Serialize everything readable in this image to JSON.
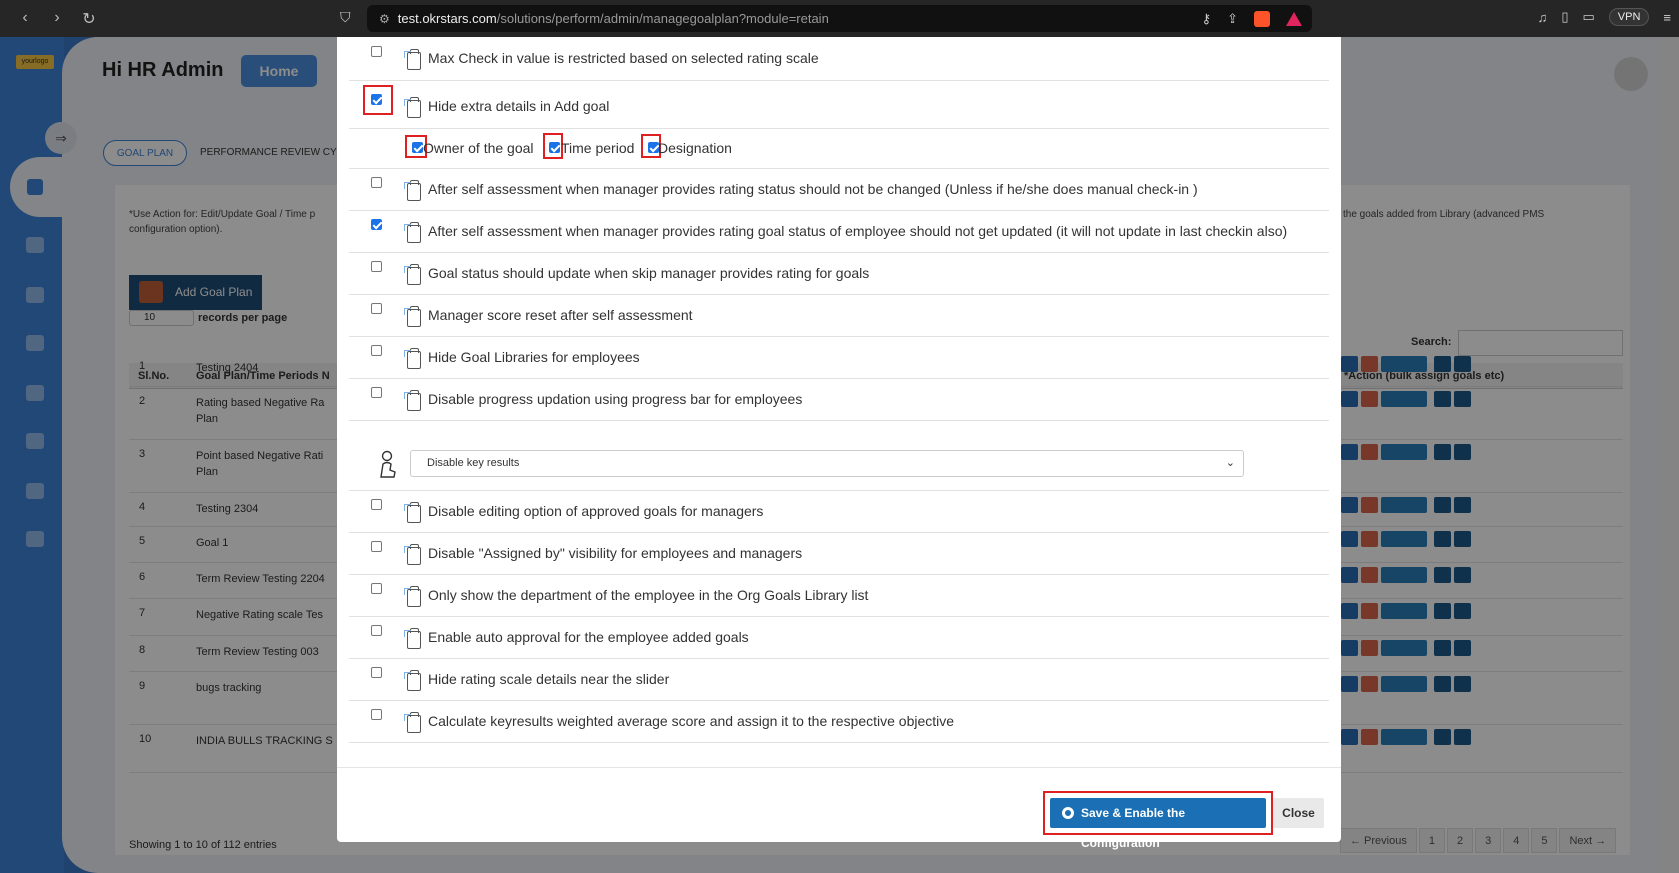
{
  "browser": {
    "url_host": "test.okrstars.com",
    "url_path": "/solutions/perform/admin/managegoalplan?module=retain",
    "vpn_label": "VPN"
  },
  "app": {
    "logo_text": "yourlogo",
    "greeting": "Hi HR Admin",
    "home_label": "Home",
    "tabs": [
      "GOAL PLAN",
      "PERFORMANCE REVIEW CY"
    ],
    "note_left": "*Use Action for: Edit/Update Goal / Time p configuration option).",
    "note_right": "the goals added from Library (advanced PMS",
    "add_goal_plan": "Add Goal Plan",
    "records_per_page_value": "10",
    "records_per_page_label": "records per page",
    "search_label": "Search:",
    "table": {
      "headers": [
        "Sl.No.",
        "Goal Plan/Time Periods N",
        "*Action (bulk assign goals etc)"
      ],
      "rows": [
        {
          "n": "1",
          "name": "Testing 2404"
        },
        {
          "n": "2",
          "name": "Rating based Negative Ra Plan"
        },
        {
          "n": "3",
          "name": "Point based Negative Rati Plan"
        },
        {
          "n": "4",
          "name": "Testing 2304"
        },
        {
          "n": "5",
          "name": "Goal 1"
        },
        {
          "n": "6",
          "name": "Term Review Testing 2204"
        },
        {
          "n": "7",
          "name": "Negative Rating scale Tes"
        },
        {
          "n": "8",
          "name": "Term Review Testing 003"
        },
        {
          "n": "9",
          "name": "bugs tracking"
        },
        {
          "n": "10",
          "name": "INDIA BULLS TRACKING S"
        }
      ]
    },
    "showing": "Showing 1 to 10 of 112 entries",
    "pager": [
      "← Previous",
      "1",
      "2",
      "3",
      "4",
      "5",
      "Next →"
    ]
  },
  "modal": {
    "options": [
      {
        "label": "Max Check in value is restricted based on selected rating scale",
        "checked": false
      },
      {
        "label": "Hide extra details in Add goal",
        "checked": true
      },
      {
        "label": "After self assessment when manager provides rating status should not be changed (Unless if he/she does manual check-in )",
        "checked": false
      },
      {
        "label": "After self assessment when manager provides rating goal status of employee should not get updated (it will not update in last checkin also)",
        "checked": true
      },
      {
        "label": "Goal status should update when skip manager provides rating for goals",
        "checked": false
      },
      {
        "label": "Manager score reset after self assessment",
        "checked": false
      },
      {
        "label": "Hide Goal Libraries for employees",
        "checked": false
      },
      {
        "label": "Disable progress updation using progress bar for employees",
        "checked": false
      },
      {
        "label": "Disable editing option of approved goals for managers",
        "checked": false
      },
      {
        "label": "Disable \"Assigned by\" visibility for employees and managers",
        "checked": false
      },
      {
        "label": "Only show the department of the employee in the Org Goals Library list",
        "checked": false
      },
      {
        "label": "Enable auto approval for the employee added goals",
        "checked": false
      },
      {
        "label": "Hide rating scale details near the slider",
        "checked": false
      },
      {
        "label": "Calculate keyresults weighted average score and assign it to the respective objective",
        "checked": false
      }
    ],
    "sub_options": [
      {
        "label": "Owner of the goal",
        "checked": true
      },
      {
        "label": "Time period",
        "checked": true
      },
      {
        "label": "Designation",
        "checked": true
      }
    ],
    "key_results_select": "Disable key results",
    "save_label": "Save & Enable the Configuration",
    "close_label": "Close"
  }
}
